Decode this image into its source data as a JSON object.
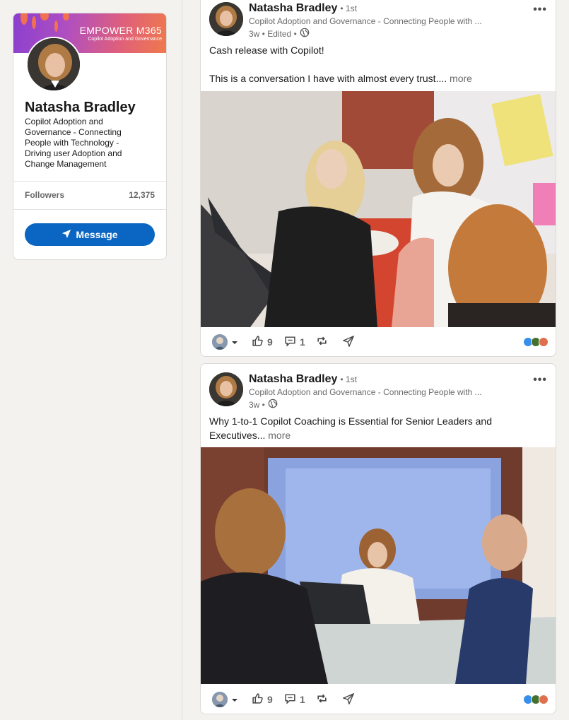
{
  "profile": {
    "banner_title": "EMPOWER M365",
    "banner_subtitle": "Copilot Adoption and Governance",
    "name": "Natasha Bradley",
    "headline": "Copilot Adoption and Governance - Connecting People with Technology - Driving user Adoption and Change Management",
    "followers_label": "Followers",
    "followers_count": "12,375",
    "message_label": "Message"
  },
  "posts": [
    {
      "author": "Natasha Bradley",
      "degree": "• 1st",
      "headline": "Copilot Adoption and Governance - Connecting People with ...",
      "time": "3w • Edited •",
      "text_line1": "Cash release with Copilot!",
      "text_line2": "This is a conversation I have with almost every trust....",
      "more_label": "more",
      "likes": "9",
      "comments": "1"
    },
    {
      "author": "Natasha Bradley",
      "degree": "• 1st",
      "headline": "Copilot Adoption and Governance - Connecting People with ...",
      "time": "3w •",
      "text_line1": "Why 1-to-1 Copilot Coaching is Essential for Senior Leaders and",
      "text_line2": "Executives...",
      "more_label": "more",
      "likes": "9",
      "comments": "1"
    }
  ],
  "icons": {
    "menu": "ellipsis-icon",
    "globe": "globe-icon",
    "like": "thumbs-up-icon",
    "comment": "comment-icon",
    "repost": "repost-icon",
    "send": "send-icon"
  },
  "colors": {
    "accent": "#0a66c2",
    "background": "#f4f2ee"
  }
}
